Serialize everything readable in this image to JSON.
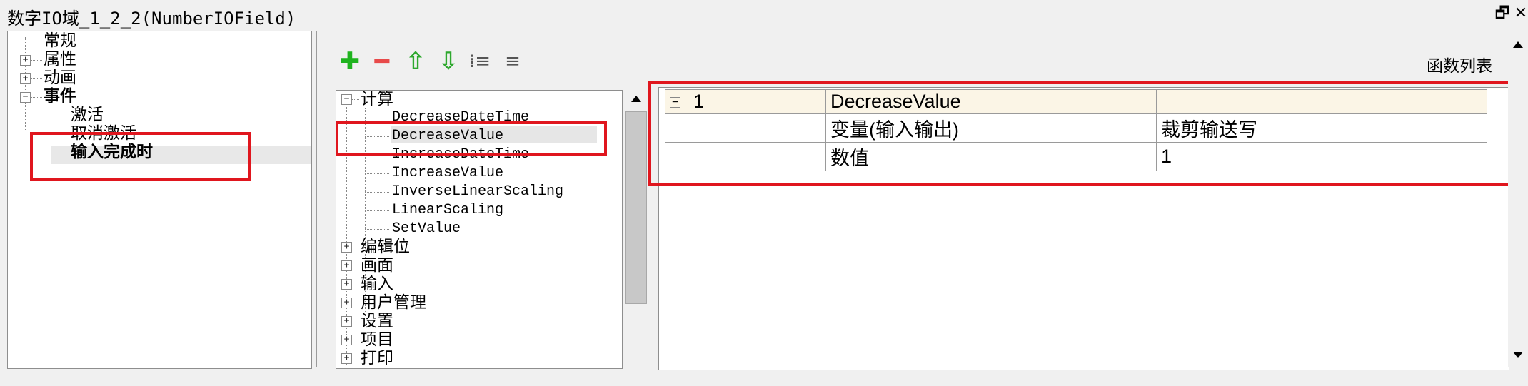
{
  "window": {
    "title": "数字IO域_1_2_2(NumberIOField)",
    "restore_icon": "restore-icon",
    "close_icon": "close-icon",
    "restore_glyph": "🗗",
    "close_glyph": "✕"
  },
  "left_tree": {
    "items": [
      {
        "label": "常规"
      },
      {
        "label": "属性",
        "expander": "+"
      },
      {
        "label": "动画",
        "expander": "+"
      },
      {
        "label": "事件",
        "expander": "−"
      },
      {
        "label": "激活"
      },
      {
        "label": "取消激活"
      },
      {
        "label": "输入完成时"
      }
    ]
  },
  "toolbar": {
    "add_glyph": "✚",
    "remove_glyph": "━",
    "up_glyph": "⇧",
    "down_glyph": "⇩",
    "indent_glyph": "⁞≡",
    "outdent_glyph": "≡",
    "func_list_label": "函数列表"
  },
  "function_tree": {
    "group_label": "计算",
    "group_expander": "−",
    "functions": [
      "DecreaseDateTime",
      "DecreaseValue",
      "IncreaseDateTime",
      "IncreaseValue",
      "InverseLinearScaling",
      "LinearScaling",
      "SetValue"
    ],
    "other_groups": [
      "编辑位",
      "画面",
      "输入",
      "用户管理",
      "设置",
      "项目",
      "打印"
    ]
  },
  "grid": {
    "header": {
      "expander": "−",
      "index": "1",
      "function": "DecreaseValue",
      "extra": ""
    },
    "params": [
      {
        "name": "变量(输入输出)",
        "value": "裁剪输送写"
      },
      {
        "name": "数值",
        "value": "1"
      }
    ]
  },
  "colors": {
    "highlight_red": "#e0161e",
    "add_green": "#1fb31f",
    "remove_red": "#e84a4a",
    "arrow_green": "#2ea82e"
  }
}
